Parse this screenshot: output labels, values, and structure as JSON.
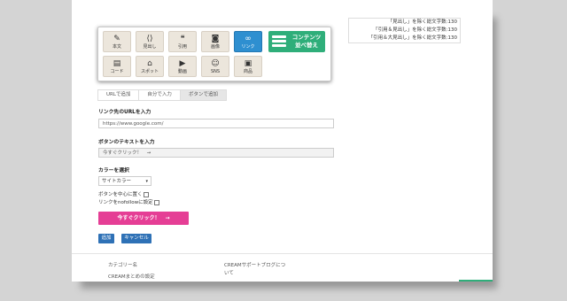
{
  "palette": {
    "tools_row1": [
      {
        "label": "本文",
        "icon": "pen-icon",
        "glyph": "✎"
      },
      {
        "label": "見出し",
        "icon": "code-brackets-icon",
        "glyph": "⟨⟩"
      },
      {
        "label": "引用",
        "icon": "quote-icon",
        "glyph": "❝"
      },
      {
        "label": "画像",
        "icon": "camera-icon",
        "glyph": "◙"
      },
      {
        "label": "リンク",
        "icon": "link-icon",
        "glyph": "∞"
      }
    ],
    "tools_row2": [
      {
        "label": "コード",
        "icon": "code-window-icon",
        "glyph": "▤"
      },
      {
        "label": "スポット",
        "icon": "spot-icon",
        "glyph": "⌂"
      },
      {
        "label": "動画",
        "icon": "video-icon",
        "glyph": "▶"
      },
      {
        "label": "SNS",
        "icon": "sns-icon",
        "glyph": "☺"
      },
      {
        "label": "商品",
        "icon": "shopping-bag-icon",
        "glyph": "▣"
      }
    ],
    "swap_label_line1": "コンテンツ",
    "swap_label_line2": "並べ替え",
    "active_tool": "リンク",
    "accent_color": "#2e8fd0",
    "swap_color": "#2fae7a"
  },
  "char_counts": [
    "「見出し」を除く総文字数:130",
    "「引用＆見出し」を除く総文字数:130",
    "「引用＆大見出し」を除く総文字数:130"
  ],
  "tabs": [
    "URLで追加",
    "自分で入力",
    "ボタンで追加"
  ],
  "active_tab": "ボタンで追加",
  "form": {
    "url_label": "リンク先のURLを入力",
    "url_value": "https://www.google.com/",
    "text_label": "ボタンのテキストを入力",
    "text_value": "今すぐクリック！　→",
    "color_label": "カラーを選択",
    "color_value": "サイトカラー",
    "center_label": "ボタンを中心に置く",
    "nofollow_label": "リンクをnofollowに設定",
    "cta_label": "今すぐクリック！　→",
    "cta_color": "#e53e95",
    "add_label": "追加",
    "cancel_label": "キャンセル",
    "button_color": "#2e71b6"
  },
  "footer": {
    "category_title": "カテゴリー名",
    "category_item": "CREAMまとめの設定",
    "blog_line1": "CREAMサポートブログにつ",
    "blog_line2": "いて"
  }
}
